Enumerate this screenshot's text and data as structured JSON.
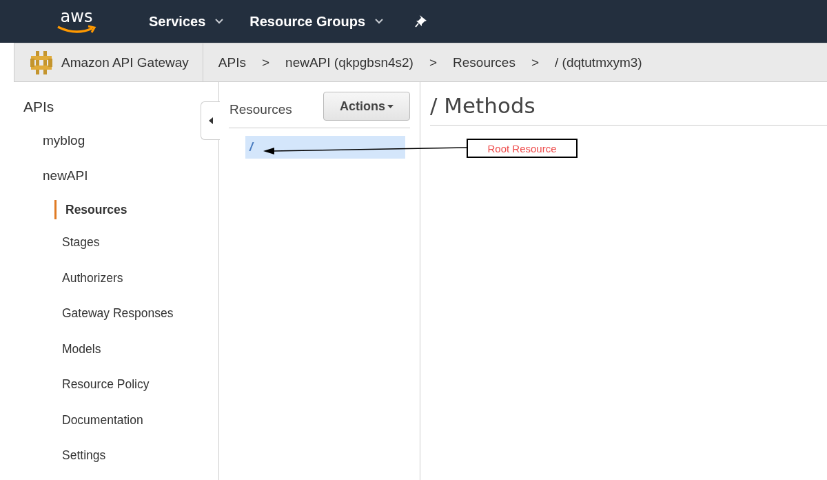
{
  "top_nav": {
    "logo_text": "aws",
    "menus": [
      {
        "label": "Services",
        "dropdown": true
      },
      {
        "label": "Resource Groups",
        "dropdown": true
      }
    ]
  },
  "breadcrumb_bar": {
    "service": "Amazon API Gateway",
    "crumbs": [
      "APIs",
      "newAPI (qkpgbsn4s2)",
      "Resources",
      "/ (dqtutmxym3)"
    ],
    "separator": ">"
  },
  "sidebar": {
    "title": "APIs",
    "items": [
      {
        "label": "myblog",
        "selected": false
      },
      {
        "label": "newAPI",
        "selected": false,
        "children": [
          {
            "label": "Resources",
            "selected": true
          },
          {
            "label": "Stages",
            "selected": false
          },
          {
            "label": "Authorizers",
            "selected": false
          },
          {
            "label": "Gateway Responses",
            "selected": false
          },
          {
            "label": "Models",
            "selected": false
          },
          {
            "label": "Resource Policy",
            "selected": false
          },
          {
            "label": "Documentation",
            "selected": false
          },
          {
            "label": "Settings",
            "selected": false
          }
        ]
      }
    ]
  },
  "resources_panel": {
    "title": "Resources",
    "actions_button": "Actions",
    "tree": [
      {
        "label": "/",
        "selected": true
      }
    ]
  },
  "methods_panel": {
    "title": "/ Methods"
  },
  "annotation": {
    "label": "Root Resource"
  }
}
